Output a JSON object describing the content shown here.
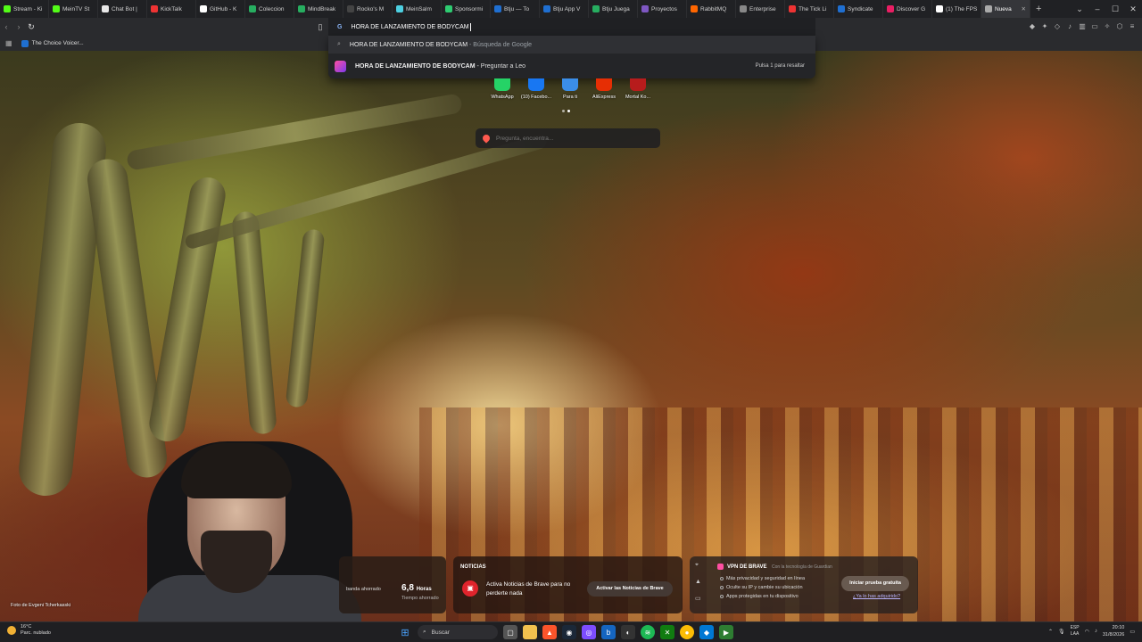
{
  "tabs": [
    {
      "label": "Stream - Ki",
      "color": "#53fc18"
    },
    {
      "label": "MeinTV St",
      "color": "#53fc18"
    },
    {
      "label": "Chat Bot |",
      "color": "#e8e8e8"
    },
    {
      "label": "KickTalk",
      "color": "#e33"
    },
    {
      "label": "GitHub - K",
      "color": "#ffffff"
    },
    {
      "label": "Coleccion",
      "color": "#27ae60"
    },
    {
      "label": "MindBreak",
      "color": "#27ae60"
    },
    {
      "label": "Rocko's M",
      "color": "#444"
    },
    {
      "label": "MeinSalm",
      "color": "#4dd0e1"
    },
    {
      "label": "Sponsormi",
      "color": "#2ecc71"
    },
    {
      "label": "Btju — To",
      "color": "#1f6fd1"
    },
    {
      "label": "Btju App V",
      "color": "#1f6fd1"
    },
    {
      "label": "Btju Juega",
      "color": "#27ae60"
    },
    {
      "label": "Proyectos",
      "color": "#7e57c2"
    },
    {
      "label": "RabbitMQ",
      "color": "#ff6600"
    },
    {
      "label": "Enterprise",
      "color": "#888"
    },
    {
      "label": "The Tick Li",
      "color": "#e33"
    },
    {
      "label": "Syndicate",
      "color": "#1f6fd1"
    },
    {
      "label": "Discover G",
      "color": "#e91e63"
    },
    {
      "label": "(1) The FPS",
      "color": "#ffffff"
    },
    {
      "label": "Nueva",
      "color": "#aaaaaa",
      "active": true
    }
  ],
  "omnibox": {
    "text": "HORA DE LANZAMIENTO DE BODYCAM"
  },
  "bookmarks": [
    {
      "label": "The Choice Voicer..."
    }
  ],
  "suggestions": [
    {
      "query": "HORA DE LANZAMIENTO DE BODYCAM",
      "suffix": "- Búsqueda de Google"
    },
    {
      "query": "HORA DE LANZAMIENTO DE BODYCAM",
      "suffix": "- Preguntar a Leo",
      "hint": "Pulsa 1 para resaltar"
    }
  ],
  "top_sites": [
    {
      "label": "WhatsApp",
      "color": "#25d366"
    },
    {
      "label": "(10) Facebo...",
      "color": "#1877f2"
    },
    {
      "label": "Para ti",
      "color": "#3b8ee8"
    },
    {
      "label": "AliExpress",
      "color": "#e62e04"
    },
    {
      "label": "Mortal Ko...",
      "color": "#b71c1c"
    }
  ],
  "page_search": {
    "placeholder": "Pregunta, encuentra..."
  },
  "photo_credit": "Foto de Evgeni Tcherkasski",
  "stats": {
    "bandwidth_label": "banda ahorrado",
    "time_value": "6,8",
    "time_unit": "Horas",
    "time_label": "Tiempo ahorrado"
  },
  "news": {
    "header": "NOTICIAS",
    "message": "Activa Noticias de Brave para no perderte nada",
    "button": "Activar las Noticias de Brave"
  },
  "vpn": {
    "title": "VPN DE BRAVE",
    "subtitle": "Con la tecnología de Guardian",
    "bullets": [
      "Más privacidad y seguridad en línea",
      "Oculte su IP y cambie su ubicación",
      "Apps protegidas en tu dispositivo"
    ],
    "trial_button": "Iniciar prueba gratuita",
    "link": "¿Ya lo has adquirido?"
  },
  "taskbar": {
    "weather_temp": "16°C",
    "weather_desc": "Parc. nublado",
    "search_label": "Buscar",
    "lang_top": "ESP",
    "lang_bottom": "LAA",
    "time": "20:10",
    "date": "31/8/2026"
  }
}
